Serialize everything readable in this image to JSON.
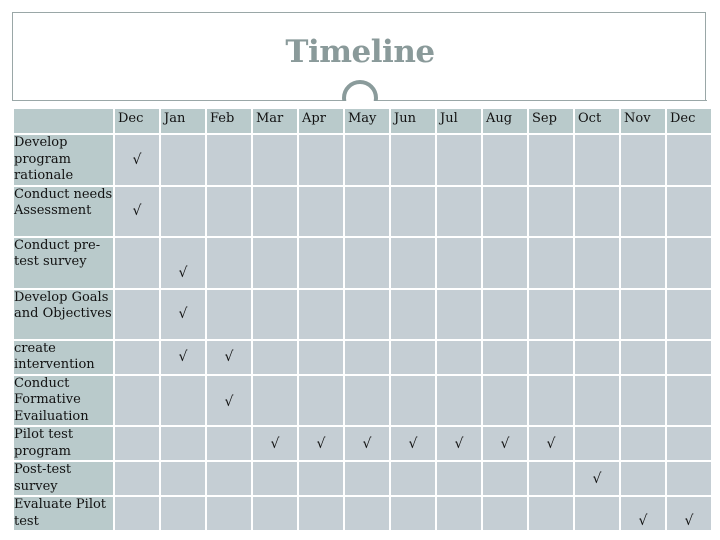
{
  "title": "Timeline",
  "check_symbol": "√",
  "colors": {
    "title": "#8a9a9a",
    "header_bg": "#b9cacb",
    "cell_bg": "#c5ced4",
    "frame": "#9aa7a7"
  },
  "months": [
    "Dec",
    "Jan",
    "Feb",
    "Mar",
    "Apr",
    "May",
    "Jun",
    "Jul",
    "Aug",
    "Sep",
    "Oct",
    "Nov",
    "Dec"
  ],
  "tasks": [
    {
      "label": "Develop program rationale",
      "checks": [
        "Dec"
      ],
      "cols": [
        0
      ]
    },
    {
      "label": "Conduct needs Assessment",
      "checks": [
        "Dec"
      ],
      "cols": [
        0
      ]
    },
    {
      "label": "Conduct pre-test survey",
      "checks": [
        "Jan"
      ],
      "cols": [
        1
      ]
    },
    {
      "label": "Develop Goals and Objectives",
      "checks": [
        "Jan"
      ],
      "cols": [
        1
      ]
    },
    {
      "label": "create intervention",
      "checks": [
        "Jan",
        "Feb"
      ],
      "cols": [
        1,
        2
      ]
    },
    {
      "label": "Conduct Formative Evailuation",
      "checks": [
        "Feb"
      ],
      "cols": [
        2
      ]
    },
    {
      "label": "Pilot test program",
      "checks": [
        "Mar",
        "Apr",
        "May",
        "Jun",
        "Jul",
        "Aug",
        "Sep"
      ],
      "cols": [
        3,
        4,
        5,
        6,
        7,
        8,
        9
      ]
    },
    {
      "label": "Post-test survey",
      "checks": [
        "Oct"
      ],
      "cols": [
        10
      ]
    },
    {
      "label": "Evaluate Pilot test",
      "checks": [
        "Nov",
        "Dec"
      ],
      "cols": [
        11,
        12
      ]
    }
  ]
}
